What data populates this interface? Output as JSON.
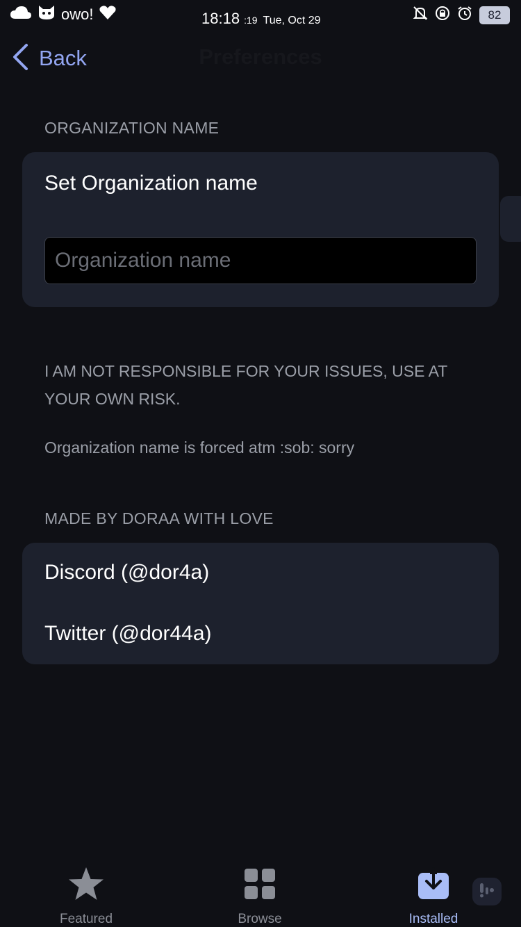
{
  "status_bar": {
    "carrier": "owo!",
    "time": "18:18",
    "seconds": ":19",
    "date": "Tue, Oct 29",
    "battery": "82",
    "icons": [
      "cloud-icon",
      "cat-face-icon",
      "heart-icon",
      "bell-off-icon",
      "rotation-lock-icon",
      "alarm-icon"
    ]
  },
  "nav": {
    "back_label": "Back",
    "title": "Preferences"
  },
  "organization_section": {
    "header": "ORGANIZATION NAME",
    "card_title": "Set Organization name",
    "input_value": "",
    "input_placeholder": "Organization name"
  },
  "notes": {
    "disclaimer": "I AM NOT RESPONSIBLE FOR YOUR ISSUES, USE AT YOUR OWN RISK.",
    "forced_note": "Organization name is forced atm :sob: sorry"
  },
  "credits_section": {
    "header": "MADE BY DORAA WITH LOVE",
    "links": [
      {
        "label": "Discord (@dor4a)"
      },
      {
        "label": "Twitter (@dor44a)"
      }
    ]
  },
  "tab_bar": {
    "tabs": [
      {
        "label": "Featured",
        "icon": "star-icon",
        "active": false
      },
      {
        "label": "Browse",
        "icon": "grid-icon",
        "active": false
      },
      {
        "label": "Installed",
        "icon": "download-icon",
        "active": true
      }
    ]
  },
  "colors": {
    "background": "#0f1015",
    "card": "#1d212d",
    "accent": "#93a6f2",
    "muted_text": "#9b9fa8"
  }
}
